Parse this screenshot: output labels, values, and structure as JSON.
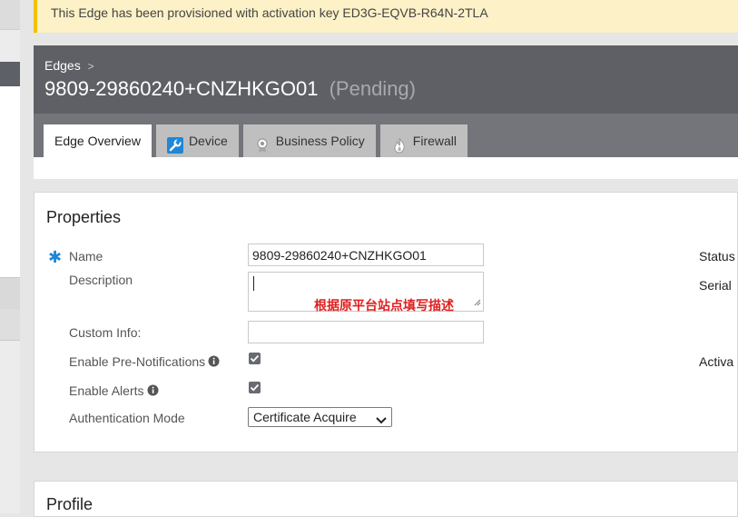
{
  "banner": {
    "text": "This Edge has been provisioned with activation key ED3G-EQVB-R64N-2TLA"
  },
  "header": {
    "breadcrumb": "Edges",
    "breadcrumb_sep": ">",
    "title": "9809-29860240+CNZHKGO01",
    "status": "(Pending)"
  },
  "tabs": [
    {
      "label": "Edge Overview",
      "icon": "none"
    },
    {
      "label": "Device",
      "icon": "wrench-icon"
    },
    {
      "label": "Business Policy",
      "icon": "ribbon-icon"
    },
    {
      "label": "Firewall",
      "icon": "flame-icon"
    }
  ],
  "properties": {
    "heading": "Properties",
    "required_mark": "✱",
    "name_label": "Name",
    "name_value": "9809-29860240+CNZHKGO01",
    "description_label": "Description",
    "description_note": "根据原平台站点填写描述",
    "custom_info_label": "Custom Info:",
    "custom_info_value": "",
    "pre_notifications_label": "Enable Pre-Notifications",
    "pre_notifications_checked": true,
    "alerts_label": "Enable Alerts",
    "alerts_checked": true,
    "auth_mode_label": "Authentication Mode",
    "auth_mode_value": "Certificate Acquire",
    "right_labels": {
      "status": "Status",
      "serial": "Serial",
      "activation": "Activa"
    }
  },
  "profile": {
    "heading": "Profile"
  },
  "colors": {
    "accent_blue": "#1f87d8",
    "header_bg": "#5f6066",
    "tabbar_bg": "#74757a",
    "banner_bg": "#fcf1c7",
    "note_red": "#e02020"
  }
}
